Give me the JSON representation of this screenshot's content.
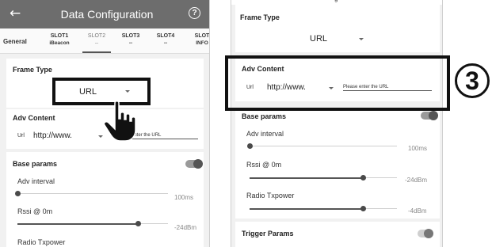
{
  "left": {
    "header": {
      "back_glyph": "←",
      "title": "Data Configuration",
      "help_glyph": "?"
    },
    "tabs": [
      {
        "label": "General",
        "sub": ""
      },
      {
        "label": "SLOT1",
        "sub": "iBeacon"
      },
      {
        "label": "SLOT2",
        "sub": "--"
      },
      {
        "label": "SLOT3",
        "sub": "--"
      },
      {
        "label": "SLOT4",
        "sub": "--"
      },
      {
        "label": "SLOT",
        "sub": "INFO"
      }
    ],
    "frame_type": {
      "label": "Frame Type",
      "value": "URL"
    },
    "adv_content": {
      "label": "Adv Content",
      "prefix_label": "Url",
      "scheme": "http://www.",
      "input_placeholder": "Please enter the URL"
    },
    "base_params": {
      "label": "Base params",
      "toggle_on": true,
      "adv_interval": {
        "label": "Adv interval",
        "value": "100ms",
        "level": 0
      },
      "rssi": {
        "label": "Rssi @ 0m",
        "value": "-24dBm",
        "level": 0.8
      },
      "radio_txpower": {
        "label": "Radio Txpower"
      }
    }
  },
  "right": {
    "top_text": "g",
    "frame_type": {
      "label": "Frame Type",
      "value": "URL"
    },
    "adv_content": {
      "label": "Adv Content",
      "prefix_label": "Url",
      "scheme": "http://www.",
      "input_placeholder": "Please enter the URL"
    },
    "base_params": {
      "label": "Base params",
      "toggle_on": true,
      "adv_interval": {
        "label": "Adv interval",
        "value": "100ms",
        "level": 0
      },
      "rssi": {
        "label": "Rssi @ 0m",
        "value": "-24dBm",
        "level": 0.77
      },
      "radio_txpower": {
        "label": "Radio Txpower",
        "value": "-4dBm",
        "level": 0.77
      }
    },
    "trigger_params": {
      "label": "Trigger Params",
      "toggle_on": false
    }
  },
  "step_number": "3",
  "icons": {
    "hand": "pointing-hand-icon",
    "back": "arrow-left-icon",
    "help": "question-circle-icon"
  },
  "colors": {
    "appbar": "#6d6d6d",
    "highlight": "#111111"
  }
}
